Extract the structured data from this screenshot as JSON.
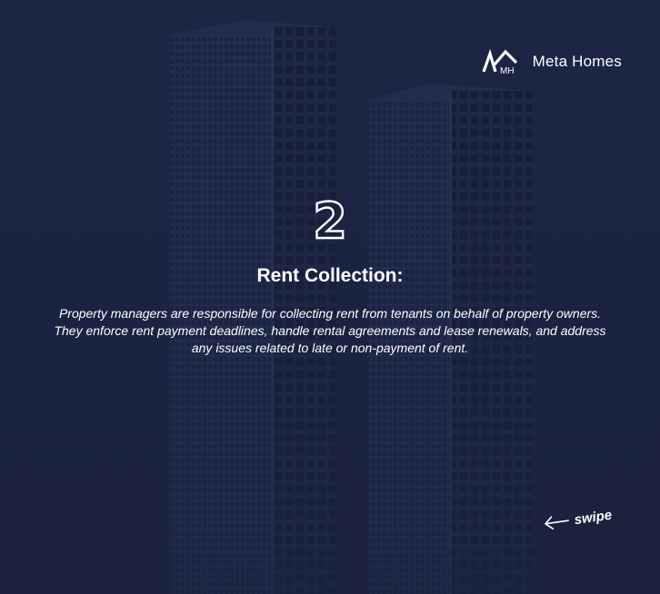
{
  "brand": {
    "logo_icon": "mh-house-logo-icon",
    "logo_initials": "MH",
    "name": "Meta Homes"
  },
  "slide": {
    "number": "2",
    "title": "Rent Collection:",
    "body": "Property managers are responsible for collecting rent from tenants on behalf of property owners. They enforce rent payment deadlines, handle rental agreements and lease renewals, and address any issues related to late or non-payment of rent."
  },
  "nav": {
    "swipe_label": "swipe",
    "swipe_icon": "arrow-left-icon"
  },
  "colors": {
    "background": "#1b2442",
    "building": "#222c4c",
    "window": "#161e38",
    "text": "#ffffff"
  }
}
